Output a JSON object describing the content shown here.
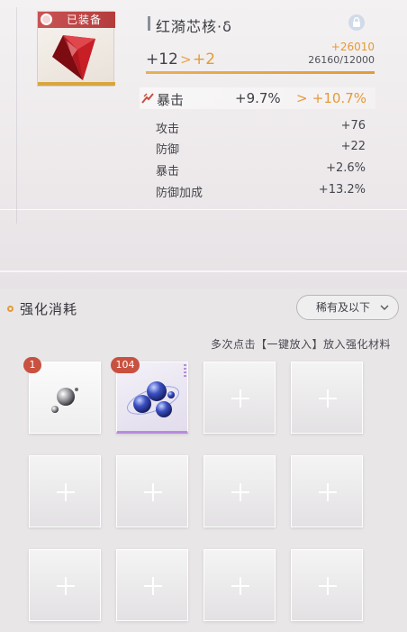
{
  "item": {
    "name": "红漪芯核·δ",
    "equipped_label": "已装备",
    "level_from": "+12",
    "level_to": "+2",
    "level_arrow": ">",
    "exp_gain": "+26010",
    "exp_total": "26160/12000",
    "exp_progress": 1.0,
    "icons": {
      "lock": "lock-icon",
      "gem": "red-gem-icon"
    }
  },
  "main_stat": {
    "label": "暴击",
    "from": "+9.7%",
    "arrow": ">",
    "to": "+10.7%"
  },
  "sub_stats": [
    {
      "label": "攻击",
      "value": "+76"
    },
    {
      "label": "防御",
      "value": "+22"
    },
    {
      "label": "暴击",
      "value": "+2.6%"
    },
    {
      "label": "防御加成",
      "value": "+13.2%"
    }
  ],
  "consume": {
    "title": "强化消耗",
    "filter": "稀有及以下",
    "hint": "多次点击【一键放入】放入强化材料",
    "materials": [
      {
        "count": "1",
        "kind": "silver-orb"
      },
      {
        "count": "104",
        "kind": "blue-orb-cluster"
      }
    ],
    "total_slots": 12
  },
  "colors": {
    "accent": "#e39b36",
    "badge": "#c8513f",
    "equipped": "#b43b3b",
    "purple_rarity": "#b88be0"
  }
}
